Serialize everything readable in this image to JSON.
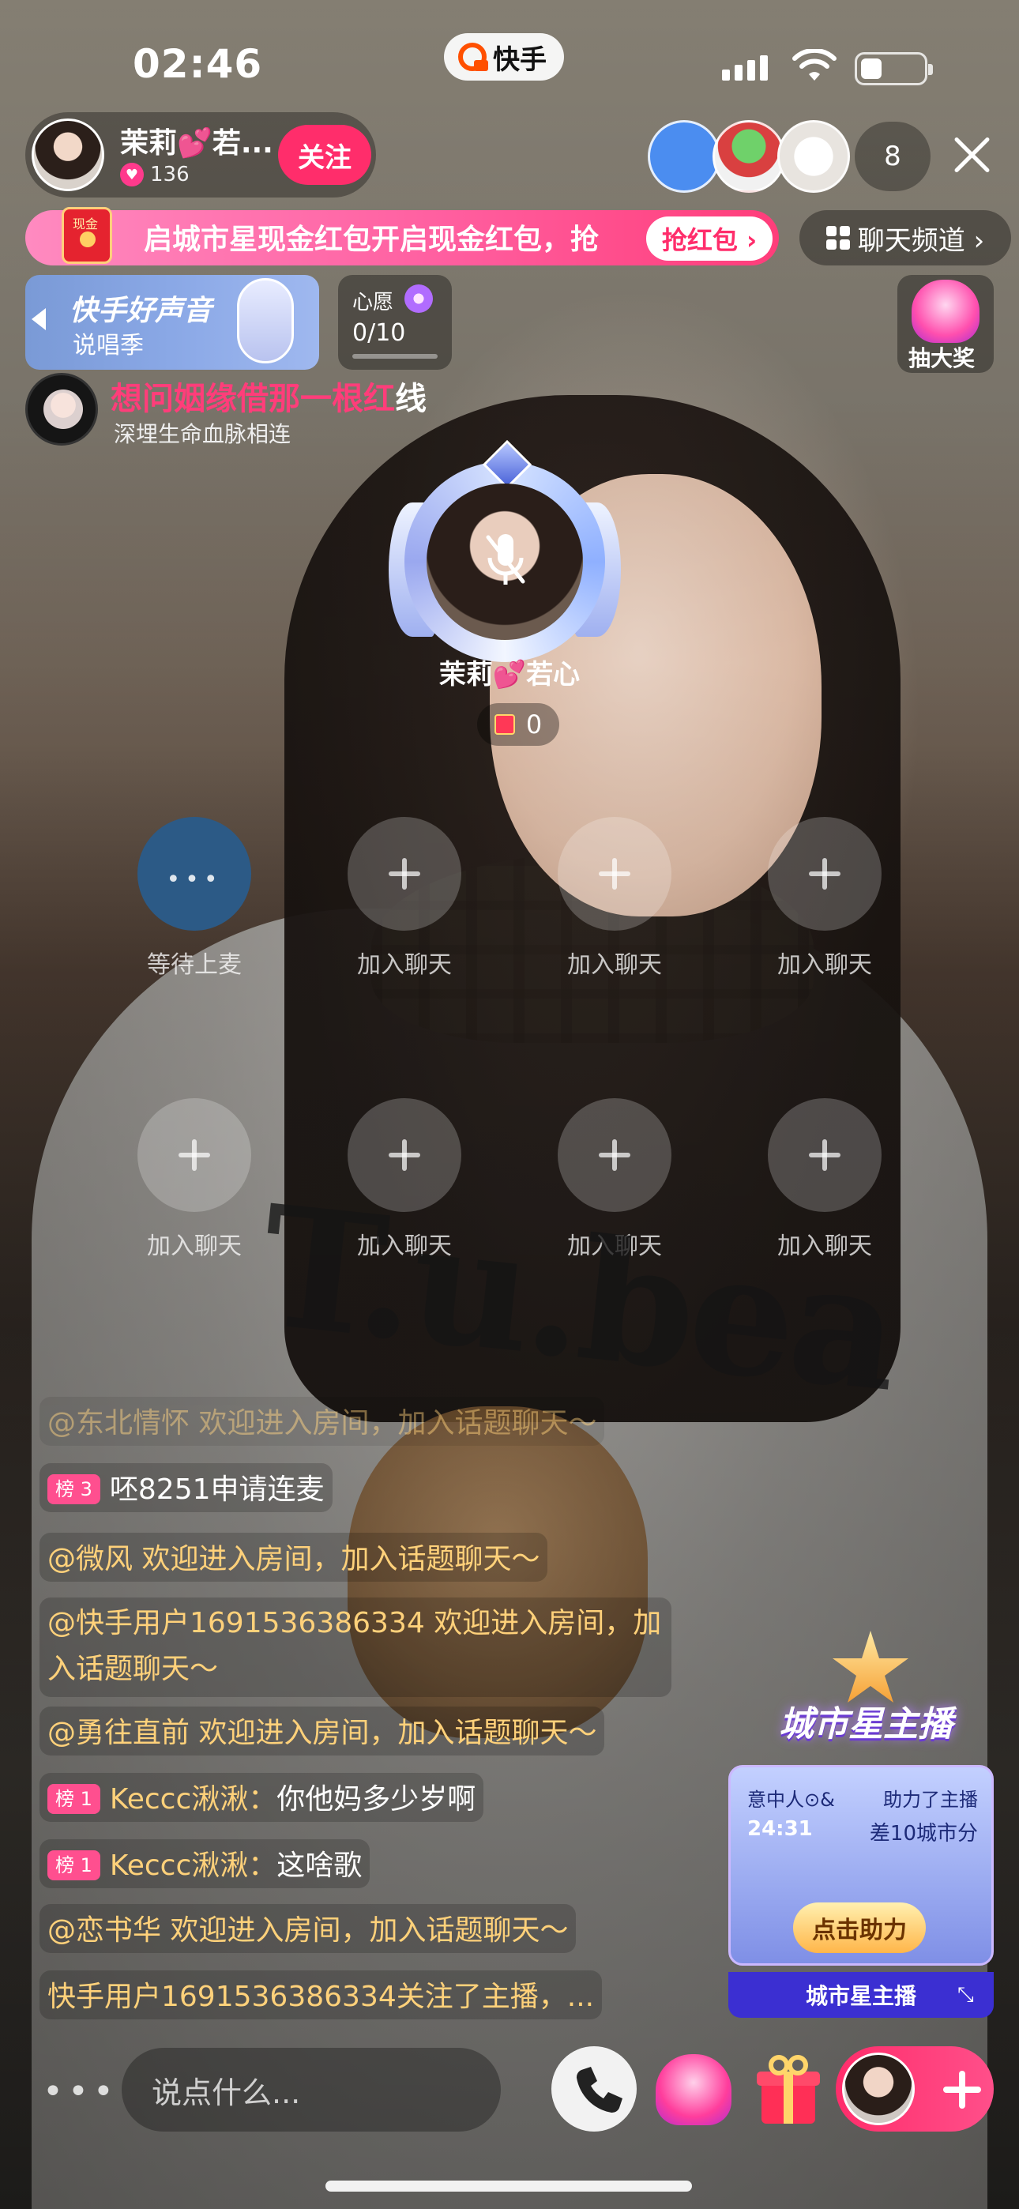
{
  "status_bar": {
    "time": "02:46",
    "app_name": "快手"
  },
  "host": {
    "name": "茉莉💕若...",
    "likes": "136",
    "follow_label": "关注"
  },
  "viewers": {
    "count": "8"
  },
  "red_packet": {
    "tag": "现金",
    "text": "启城市星现金红包开启现金红包，抢",
    "button": "抢红包 ›"
  },
  "chat_channel": {
    "label": "聊天频道 ›"
  },
  "song_card": {
    "title": "快手好声音",
    "subtitle": "说唱季"
  },
  "wish": {
    "label": "心愿",
    "progress": "0/10"
  },
  "lottery": {
    "label": "抽大奖"
  },
  "topic": {
    "title_main": "想问姻缘借那一根红",
    "title_tail": "线",
    "subtitle": "深埋生命血脉相连"
  },
  "host_seat": {
    "name": "茉莉💕若心",
    "gift_count": "0"
  },
  "seats": [
    {
      "label": "等待上麦",
      "type": "wait",
      "icon": "more-dots-icon"
    },
    {
      "label": "加入聊天",
      "type": "empty",
      "icon": "plus-icon"
    },
    {
      "label": "加入聊天",
      "type": "empty",
      "icon": "plus-icon"
    },
    {
      "label": "加入聊天",
      "type": "empty",
      "icon": "plus-icon"
    },
    {
      "label": "加入聊天",
      "type": "empty",
      "icon": "plus-icon"
    },
    {
      "label": "加入聊天",
      "type": "empty",
      "icon": "plus-icon"
    },
    {
      "label": "加入聊天",
      "type": "empty",
      "icon": "plus-icon"
    },
    {
      "label": "加入聊天",
      "type": "empty",
      "icon": "plus-icon"
    }
  ],
  "chat": [
    {
      "prefix": "@东北情怀 ",
      "text": "欢迎进入房间，加入话题聊天～",
      "faded": true
    },
    {
      "badge": "榜 3",
      "prefix": "",
      "text": "呸8251申请连麦"
    },
    {
      "prefix": "@微风 ",
      "text": "欢迎进入房间，加入话题聊天～"
    },
    {
      "prefix": "@快手用户1691536386334 ",
      "text": "欢迎进入房间，加入话题聊天～"
    },
    {
      "prefix": "@勇往直前 ",
      "text": "欢迎进入房间，加入话题聊天～"
    },
    {
      "badge": "榜 1",
      "prefix": "Keccc湫湫：",
      "text": "你他妈多少岁啊"
    },
    {
      "badge": "榜 1",
      "prefix": "Keccc湫湫：",
      "text": "这啥歌"
    },
    {
      "prefix": "@恋书华 ",
      "text": "欢迎进入房间，加入话题聊天～"
    },
    {
      "prefix": "快手用户1691536386334",
      "text": "关注了主播，..."
    }
  ],
  "promo": {
    "title": "城市星主播",
    "helper": "意中人⊙&",
    "helper_action": "助力了主播",
    "time": "24:31",
    "gap": "差10城市分",
    "button": "点击助力",
    "footer": "城市星主播"
  },
  "bottom_bar": {
    "input_placeholder": "说点什么..."
  },
  "colors": {
    "accent": "#ff2d6b",
    "chat_gold": "#ffd17a",
    "rank_badge": "#ff4f8f",
    "promo_blue": "#3b2fd2"
  }
}
